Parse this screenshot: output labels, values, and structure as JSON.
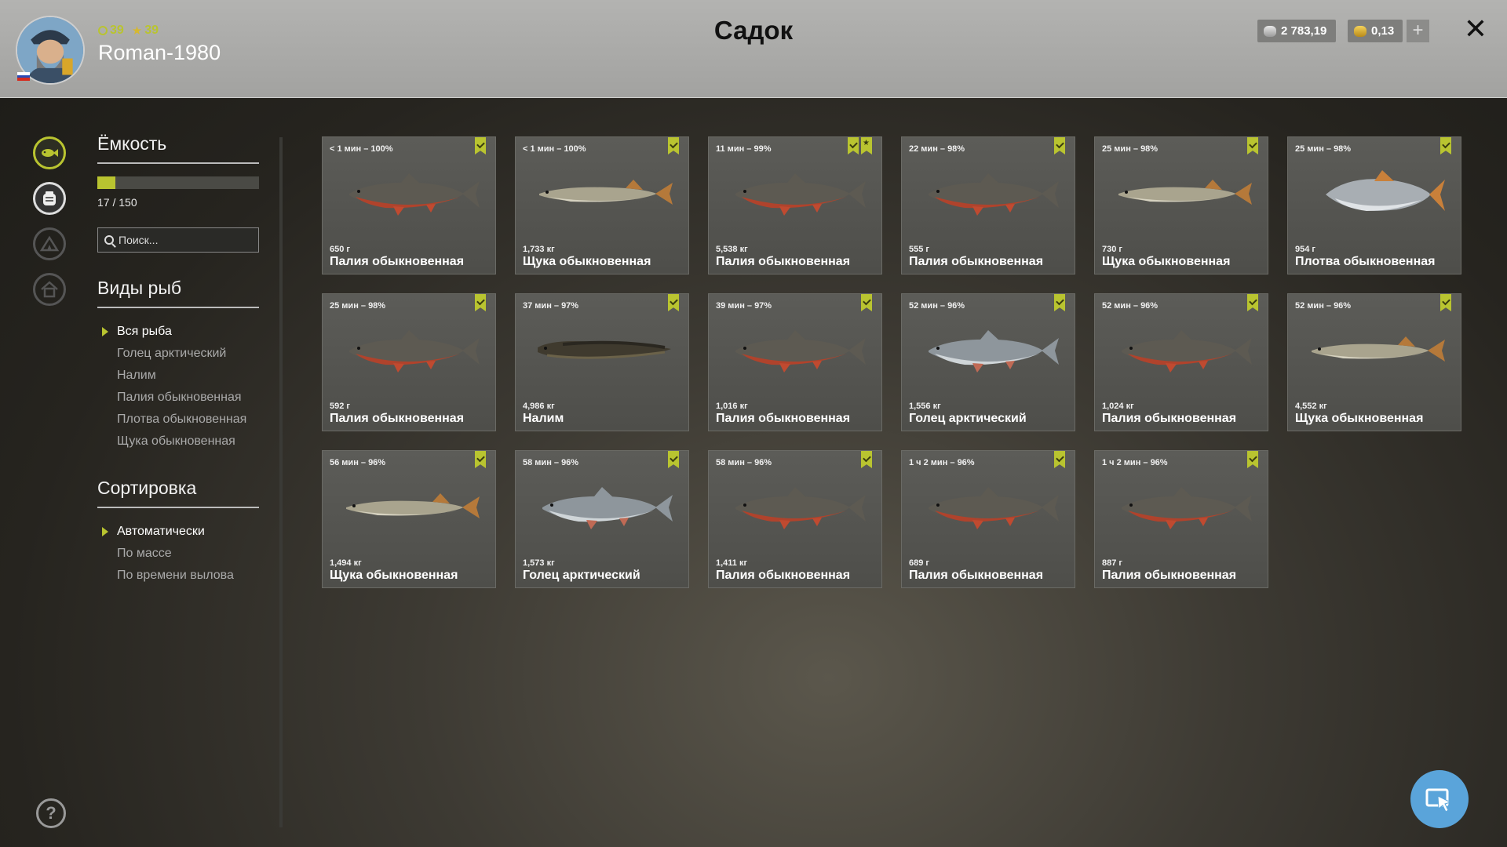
{
  "header": {
    "title": "Садок",
    "username": "Roman-1980",
    "level": "39",
    "rank": "39",
    "silver": "2 783,19",
    "gold": "0,13",
    "plus_label": "+",
    "close_label": "✕"
  },
  "panel": {
    "capacity_title": "Ёмкость",
    "capacity_used": 17,
    "capacity_max": 150,
    "capacity_text": "17 / 150",
    "search_placeholder": "Поиск...",
    "species_title": "Виды рыб",
    "species": [
      {
        "label": "Вся рыба",
        "selected": true
      },
      {
        "label": "Голец арктический",
        "selected": false
      },
      {
        "label": "Налим",
        "selected": false
      },
      {
        "label": "Палия обыкновенная",
        "selected": false
      },
      {
        "label": "Плотва обыкновенная",
        "selected": false
      },
      {
        "label": "Щука обыкновенная",
        "selected": false
      }
    ],
    "sort_title": "Сортировка",
    "sort_options": [
      {
        "label": "Автоматически",
        "selected": true
      },
      {
        "label": "По массе",
        "selected": false
      },
      {
        "label": "По времени вылова",
        "selected": false
      }
    ]
  },
  "fish": [
    {
      "time": "< 1 мин – 100%",
      "weight": "650 г",
      "name": "Палия обыкновенная",
      "kind": "char",
      "star": false
    },
    {
      "time": "< 1 мин – 100%",
      "weight": "1,733 кг",
      "name": "Щука обыкновенная",
      "kind": "pike",
      "star": false
    },
    {
      "time": "11 мин – 99%",
      "weight": "5,538 кг",
      "name": "Палия обыкновенная",
      "kind": "char",
      "star": true
    },
    {
      "time": "22 мин – 98%",
      "weight": "555 г",
      "name": "Палия обыкновенная",
      "kind": "char",
      "star": false
    },
    {
      "time": "25 мин – 98%",
      "weight": "730 г",
      "name": "Щука обыкновенная",
      "kind": "pike",
      "star": false
    },
    {
      "time": "25 мин – 98%",
      "weight": "954 г",
      "name": "Плотва обыкновенная",
      "kind": "roach",
      "star": false
    },
    {
      "time": "25 мин – 98%",
      "weight": "592 г",
      "name": "Палия обыкновенная",
      "kind": "char",
      "star": false
    },
    {
      "time": "37 мин – 97%",
      "weight": "4,986 кг",
      "name": "Налим",
      "kind": "burbot",
      "star": false
    },
    {
      "time": "39 мин – 97%",
      "weight": "1,016 кг",
      "name": "Палия обыкновенная",
      "kind": "char",
      "star": false
    },
    {
      "time": "52 мин – 96%",
      "weight": "1,556 кг",
      "name": "Голец арктический",
      "kind": "arctic",
      "star": false
    },
    {
      "time": "52 мин – 96%",
      "weight": "1,024 кг",
      "name": "Палия обыкновенная",
      "kind": "char",
      "star": false
    },
    {
      "time": "52 мин – 96%",
      "weight": "4,552 кг",
      "name": "Щука обыкновенная",
      "kind": "pike",
      "star": false
    },
    {
      "time": "56 мин – 96%",
      "weight": "1,494 кг",
      "name": "Щука обыкновенная",
      "kind": "pike",
      "star": false
    },
    {
      "time": "58 мин – 96%",
      "weight": "1,573 кг",
      "name": "Голец арктический",
      "kind": "arctic",
      "star": false
    },
    {
      "time": "58 мин – 96%",
      "weight": "1,411 кг",
      "name": "Палия обыкновенная",
      "kind": "char",
      "star": false
    },
    {
      "time": "1 ч 2 мин – 96%",
      "weight": "689 г",
      "name": "Палия обыкновенная",
      "kind": "char",
      "star": false
    },
    {
      "time": "1 ч 2 мин – 96%",
      "weight": "887 г",
      "name": "Палия обыкновенная",
      "kind": "char",
      "star": false
    }
  ],
  "colors": {
    "accent": "#b9c430",
    "fab": "#5aa4da"
  }
}
